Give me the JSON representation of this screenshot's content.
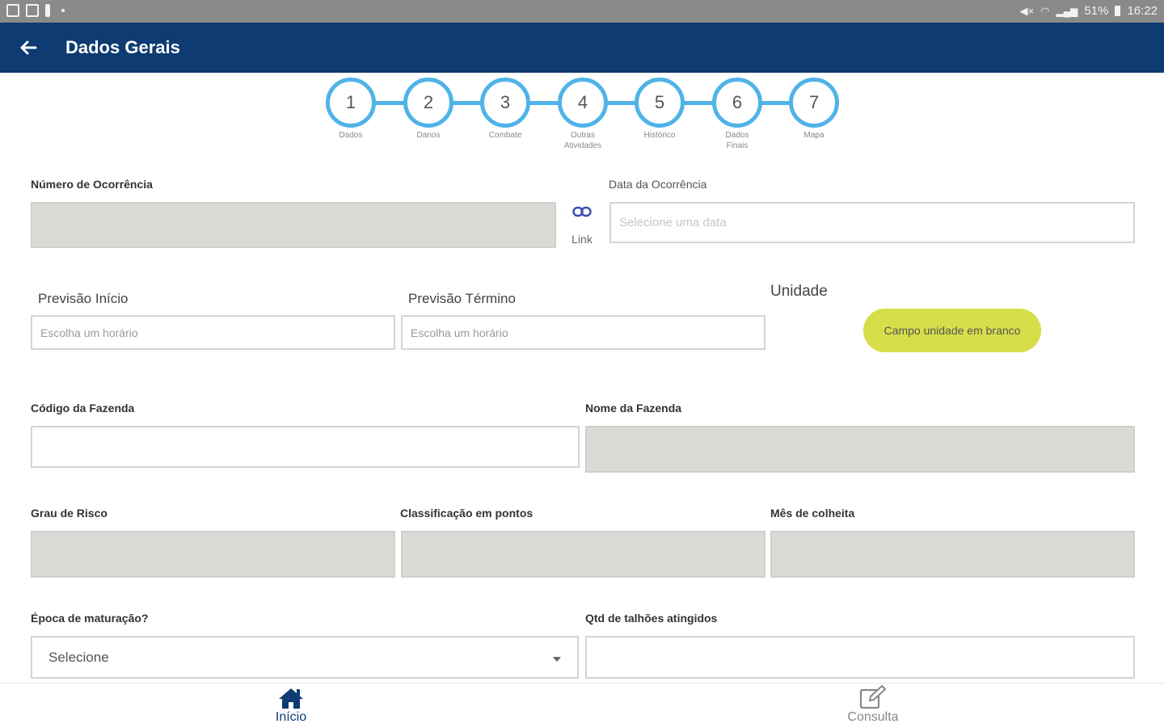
{
  "status_bar": {
    "battery": "51%",
    "time": "16:22"
  },
  "app_bar": {
    "title": "Dados Gerais"
  },
  "stepper": {
    "steps": [
      {
        "number": "1",
        "label": "Dados"
      },
      {
        "number": "2",
        "label": "Danos"
      },
      {
        "number": "3",
        "label": "Combate"
      },
      {
        "number": "4",
        "label": "Outras Atividades"
      },
      {
        "number": "5",
        "label": "Histórico"
      },
      {
        "number": "6",
        "label": "Dados Finais"
      },
      {
        "number": "7",
        "label": "Mapa"
      }
    ]
  },
  "form": {
    "numero_ocorrencia": {
      "label": "Número de Ocorrência",
      "value": ""
    },
    "link": {
      "label": "Link"
    },
    "data_ocorrencia": {
      "label": "Data da Ocorrência",
      "placeholder": "Selecione uma data"
    },
    "previsao_inicio": {
      "label": "Previsão Início",
      "placeholder": "Escolha um horário"
    },
    "previsao_termino": {
      "label": "Previsão Término",
      "placeholder": "Escolha um horário"
    },
    "unidade": {
      "label": "Unidade",
      "badge": "Campo unidade em branco",
      "badge_color": "#d8de4a"
    },
    "codigo_fazenda": {
      "label": "Código da Fazenda",
      "value": ""
    },
    "nome_fazenda": {
      "label": "Nome da Fazenda",
      "value": ""
    },
    "grau_risco": {
      "label": "Grau de Risco",
      "value": ""
    },
    "classificacao_pontos": {
      "label": "Classificação em pontos",
      "value": ""
    },
    "mes_colheita": {
      "label": "Mês de colheita",
      "value": ""
    },
    "epoca_maturacao": {
      "label": "Época de maturação?",
      "selected": "Selecione"
    },
    "qtd_talhoes": {
      "label": "Qtd de talhões atingidos",
      "value": ""
    }
  },
  "bottom_nav": {
    "items": [
      {
        "label": "Início",
        "icon": "home-icon",
        "active": true,
        "color": "#0d3b72"
      },
      {
        "label": "Consulta",
        "icon": "edit-icon",
        "active": false,
        "color": "#888888"
      }
    ]
  },
  "colors": {
    "primary": "#0d3b72",
    "step_accent": "#4fb3e8",
    "disabled_field": "#dadad6"
  }
}
